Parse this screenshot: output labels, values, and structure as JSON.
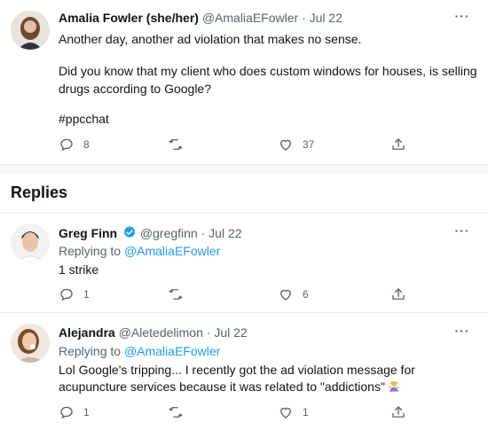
{
  "main_tweet": {
    "author_name": "Amalia Fowler (she/her)",
    "author_handle": "@AmaliaEFowler",
    "date": "Jul 22",
    "line1": "Another day, another ad violation that makes no sense.",
    "line2": "Did you know that my client who does custom windows for houses, is selling drugs according to Google?",
    "hashtag": "#ppcchat",
    "reply_count": "8",
    "retweet_count": "",
    "like_count": "37"
  },
  "replies_header": "Replies",
  "replies": [
    {
      "author_name": "Greg Finn",
      "author_handle": "@gregfinn",
      "date": "Jul 22",
      "replying_prefix": "Replying to ",
      "replying_to": "@AmaliaEFowler",
      "text": "1 strike",
      "reply_count": "1",
      "retweet_count": "",
      "like_count": "6"
    },
    {
      "author_name": "Alejandra",
      "author_handle": "@Aletedelimon",
      "date": "Jul 22",
      "replying_prefix": "Replying to ",
      "replying_to": "@AmaliaEFowler",
      "text_line1": "Lol Google's tripping... I recently got the ad violation message for",
      "text_line2": "acupuncture services because it was related to \"addictions\"",
      "reply_count": "1",
      "retweet_count": "",
      "like_count": "1"
    }
  ],
  "separator": " · ",
  "icons": {
    "reply": "reply-icon",
    "retweet": "retweet-icon",
    "like": "heart-icon",
    "share": "share-icon",
    "more": "more-icon",
    "verified": "verified-badge-icon",
    "emoji": "person-shrugging-emoji"
  },
  "colors": {
    "link": "#1d9bf0",
    "muted": "#536471",
    "divider": "#e6ecf0"
  }
}
